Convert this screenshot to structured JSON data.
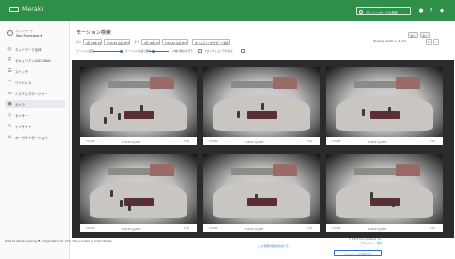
{
  "app": {
    "brand": "Meraki",
    "search_placeholder": "ダッシュボードの検索",
    "colors": {
      "topbar": "#2f8f49",
      "accent": "#2d6fcf",
      "active_nav_bg": "#e6eaf0"
    }
  },
  "sidebar": {
    "network_label": "ネットワーク",
    "network_name": "San Francisco ▾",
    "items": [
      {
        "icon": "globe-icon",
        "label": "ネットワーク全体"
      },
      {
        "icon": "shield-icon",
        "label": "セキュリティ&SD-WAN"
      },
      {
        "icon": "switch-icon",
        "label": "スイッチ"
      },
      {
        "icon": "wifi-icon",
        "label": "ワイヤレス"
      },
      {
        "icon": "monitor-icon",
        "label": "システムマネージャー"
      },
      {
        "icon": "camera-icon",
        "label": "カメラ",
        "active": true
      },
      {
        "icon": "sensor-icon",
        "label": "センサー"
      },
      {
        "icon": "insight-icon",
        "label": "インサイト"
      },
      {
        "icon": "org-icon",
        "label": "オーガナイゼーション"
      }
    ]
  },
  "main": {
    "title": "モーション検索",
    "controls": {
      "from_label": "から",
      "from_date": "4月 19年 23",
      "from_time": "3:30:49 午前 PDT",
      "to_label": "まで",
      "to_date": "4月 19年 23",
      "to_time": "3:50:49 午前 PDT",
      "timeline_button": "タイムラインをサポート動画",
      "sensitivity_label": "モーション感度",
      "sensitivity_value": "モーションの最小閾値",
      "people_label": "人物の検出を行う",
      "block_label": "ブロック | エリアを表示",
      "result_range": "Showing results 1 - 6 of 6",
      "prev_button": "前へ",
      "next_button": "次へ",
      "page": "1"
    },
    "cameras": [
      {
        "bar_left": "7:21:23",
        "bar_center": "3:34:18 午前 PDT",
        "bar_right": "7.3s"
      },
      {
        "bar_left": "7:21:23",
        "bar_center": "3:36:02 午前 PDT",
        "bar_right": "7.3s"
      },
      {
        "bar_left": "7:21:23",
        "bar_center": "3:38:47 午前 PDT",
        "bar_right": "7.3s"
      },
      {
        "bar_left": "7:21:23",
        "bar_center": "3:42:18 午前 PDT",
        "bar_right": "7.3s"
      },
      {
        "bar_left": "7:21:23",
        "bar_center": "3:44:55 午前 PDT",
        "bar_right": "7.3s"
      },
      {
        "bar_left": "7:21:23",
        "bar_center": "3:48:09 午前 PDT",
        "bar_right": "7.3s"
      }
    ],
    "more_link": "この日時の検索を続ける"
  },
  "footer": {
    "left": "Data for Meraki Learning ♥ | Organization ID: 123 | This is hosted in United States",
    "right_line1": "© 2023 Cisco Systems, Inc.",
    "right_line2": "プライバシー・条件",
    "feedback_button": "フィードバックを送信する"
  }
}
